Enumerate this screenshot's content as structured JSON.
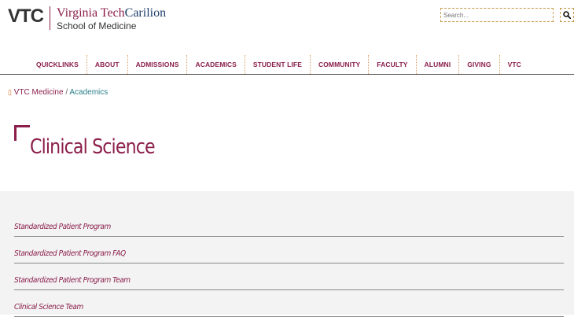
{
  "logo": {
    "vtc": "VTC",
    "line1_a": "Virginia Tech",
    "line1_b": "Carilion",
    "line2": "School of Medicine"
  },
  "search": {
    "placeholder": "Search..."
  },
  "nav": {
    "items": [
      "QUICKLINKS",
      "ABOUT",
      "ADMISSIONS",
      "ACADEMICS",
      "STUDENT LIFE",
      "COMMUNITY",
      "FACULTY",
      "ALUMNI",
      "GIVING",
      "VTC"
    ]
  },
  "breadcrumb": {
    "home": "VTC Medicine",
    "sep": "/",
    "current": "Academics"
  },
  "page": {
    "title": "Clinical Science"
  },
  "links": [
    "Standardized Patient Program",
    "Standardized Patient Program FAQ",
    "Standardized Patient Program Team",
    "Clinical Science Team"
  ],
  "colors": {
    "maroon": "#8b1f4b",
    "navy": "#1e3f6b",
    "orange": "#d87a2a",
    "teal": "#2a7f8a"
  }
}
